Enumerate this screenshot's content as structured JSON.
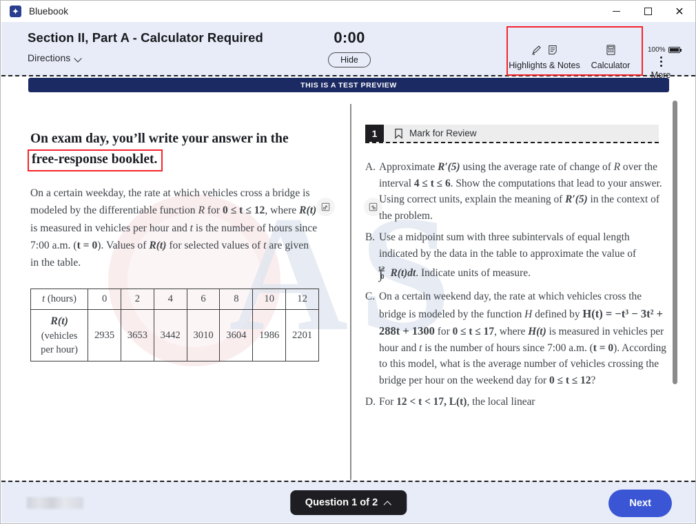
{
  "window": {
    "app_name": "Bluebook",
    "app_icon": "bluebook-star-icon",
    "minimize": "minimize-icon",
    "maximize": "maximize-icon",
    "close": "close-icon"
  },
  "header": {
    "section_title": "Section II, Part A - Calculator Required",
    "directions_label": "Directions",
    "timer": "0:00",
    "hide_label": "Hide",
    "tools": [
      {
        "label": "Highlights & Notes",
        "icons": [
          "highlighter-icon",
          "notes-icon"
        ]
      },
      {
        "label": "Calculator",
        "icons": [
          "calculator-icon"
        ]
      }
    ],
    "more_label": "More",
    "battery_percent": "100%"
  },
  "banner": {
    "text": "THIS IS A TEST PREVIEW"
  },
  "left_panel": {
    "expand_icon": "expand-panel-icon",
    "heading_line1": "On exam day, you’ll write your answer in the",
    "heading_line2": "free-response booklet.",
    "body": {
      "p1_a": "On a certain weekday, the rate at which vehicles cross a bridge is modeled by the differentiable function ",
      "p1_R": "R",
      "p1_b": " for ",
      "p1_range": "0 ≤ t ≤ 12",
      "p1_c": ", where ",
      "p1_Rt": "R(t)",
      "p1_d": " is measured in vehicles per hour and ",
      "p1_t": "t",
      "p1_e": " is the number of hours since 7:00 a.m. (",
      "p1_t0": "t = 0",
      "p1_f": "). Values of ",
      "p1_Rt2": "R(t)",
      "p1_g": " for selected values of ",
      "p1_t2": "t",
      "p1_h": " are given in the table."
    },
    "table": {
      "row1_label_math": "t",
      "row1_label_text": " (hours)",
      "row1_values": [
        "0",
        "2",
        "4",
        "6",
        "8",
        "10",
        "12"
      ],
      "row2_label_math": "R(t)",
      "row2_label_text": "(vehicles per hour)",
      "row2_values": [
        "2935",
        "3653",
        "3442",
        "3010",
        "3604",
        "1986",
        "2201"
      ]
    }
  },
  "right_panel": {
    "collapse_icon": "collapse-panel-icon",
    "question_number": "1",
    "mark_for_review_label": "Mark for Review",
    "bookmark_icon": "bookmark-icon",
    "parts": [
      {
        "letter": "A.",
        "text_1": "Approximate ",
        "math_1": "R′(5)",
        "text_2": " using the average rate of change of ",
        "math_2": "R",
        "text_3": " over the interval ",
        "math_3": "4 ≤ t ≤ 6",
        "text_4": ". Show the computations that lead to your answer. Using correct units, explain the meaning of ",
        "math_4": "R′(5)",
        "text_5": " in the context of the problem."
      },
      {
        "letter": "B.",
        "text_1": "Use a midpoint sum with three subintervals of equal length indicated by the data in the table to approximate the value of ",
        "math_1": "∫",
        "math_1_sup": "12",
        "math_1_sub": "0",
        "math_2": "R(t)dt",
        "text_2": ". Indicate units of measure."
      },
      {
        "letter": "C.",
        "text_1": "On a certain weekend day, the rate at which vehicles cross the bridge is modeled by the function ",
        "math_1": "H",
        "text_2": " defined by ",
        "math_2": "H(t) = −t³ − 3t² + 288t + 1300",
        "text_3": " for ",
        "math_3": "0 ≤ t ≤ 17",
        "text_4": ", where ",
        "math_4": "H(t)",
        "text_5": " is measured in vehicles per hour and ",
        "math_5": "t",
        "text_6": " is the number of hours since 7:00 a.m. (",
        "math_6": "t = 0",
        "text_7": "). According to this model, what is the average number of vehicles crossing the bridge per hour on the weekend day for ",
        "math_7": "0 ≤ t ≤ 12",
        "text_8": "?"
      },
      {
        "letter": "D.",
        "text_1": "For ",
        "math_1": "12 < t < 17, L(t)",
        "text_2": ", the local linear"
      }
    ]
  },
  "footer": {
    "question_pill": "Question 1 of 2",
    "next_label": "Next"
  }
}
